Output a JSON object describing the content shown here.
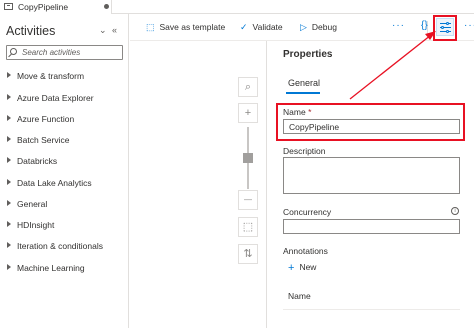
{
  "tab": {
    "title": "CopyPipeline"
  },
  "activities": {
    "title": "Activities",
    "collapse_glyph": "⌄",
    "hide_glyph": "«",
    "search_placeholder": "Search activities",
    "categories": [
      {
        "label": "Move & transform"
      },
      {
        "label": "Azure Data Explorer"
      },
      {
        "label": "Azure Function"
      },
      {
        "label": "Batch Service"
      },
      {
        "label": "Databricks"
      },
      {
        "label": "Data Lake Analytics"
      },
      {
        "label": "General"
      },
      {
        "label": "HDInsight"
      },
      {
        "label": "Iteration & conditionals"
      },
      {
        "label": "Machine Learning"
      }
    ]
  },
  "toolbar": {
    "save_template_label": "Save as template",
    "validate_label": "Validate",
    "debug_label": "Debug",
    "more_glyph": "···",
    "code_glyph": "{}"
  },
  "canvas": {
    "search_glyph": "⌕",
    "zoom_in_glyph": "+",
    "zoom_out_glyph": "—",
    "fit_glyph": "⬚",
    "layout_glyph": "⇅",
    "zoom_level": 0.5
  },
  "properties": {
    "title": "Properties",
    "tab_general": "General",
    "name_label": "Name",
    "name_required_mark": "*",
    "name_value": "CopyPipeline",
    "description_label": "Description",
    "description_value": "",
    "concurrency_label": "Concurrency",
    "concurrency_value": "",
    "info_glyph": "i",
    "annotations_label": "Annotations",
    "new_label": "New",
    "name_column_header": "Name"
  },
  "colors": {
    "accent": "#0078d4",
    "annotation_red": "#e81123"
  }
}
